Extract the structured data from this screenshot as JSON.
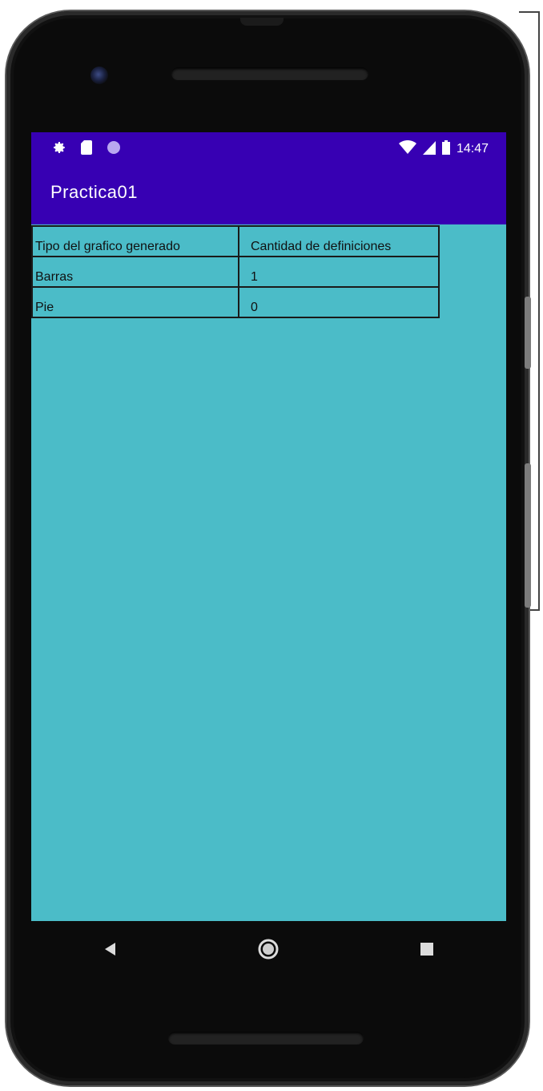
{
  "app": {
    "title": "Practica01"
  },
  "status_bar": {
    "time": "14:47",
    "left_icons": [
      "settings-icon",
      "sd-card-icon",
      "circle-notification-icon"
    ],
    "right_icons": [
      "wifi-icon",
      "cellular-signal-icon",
      "battery-icon"
    ]
  },
  "table": {
    "rows": [
      [
        "Tipo del grafico generado",
        "Cantidad de definiciones"
      ],
      [
        "Barras",
        "1"
      ],
      [
        "Pie",
        "0"
      ]
    ]
  },
  "nav": {
    "icons": [
      "back-icon",
      "home-icon",
      "recents-icon"
    ]
  },
  "colors": {
    "app_bar": "#3700b3",
    "screen_background": "#4bbcc8"
  }
}
